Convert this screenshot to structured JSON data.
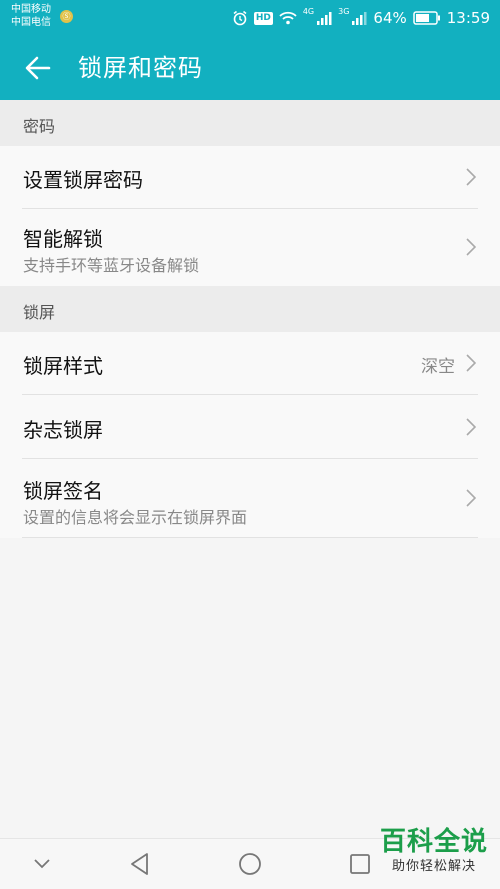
{
  "status_bar": {
    "carrier_1": "中国移动",
    "carrier_2": "中国电信",
    "carrier_badge": "Ⓢ",
    "hd_label": "HD",
    "net_1": "4G",
    "net_2": "3G",
    "battery": "64%",
    "time": "13:59"
  },
  "app_bar": {
    "title": "锁屏和密码"
  },
  "sections": [
    {
      "header": "密码",
      "items": [
        {
          "title": "设置锁屏密码"
        },
        {
          "title": "智能解锁",
          "subtitle": "支持手环等蓝牙设备解锁"
        }
      ]
    },
    {
      "header": "锁屏",
      "items": [
        {
          "title": "锁屏样式",
          "value": "深空"
        },
        {
          "title": "杂志锁屏"
        },
        {
          "title": "锁屏签名",
          "subtitle": "设置的信息将会显示在锁屏界面"
        }
      ]
    }
  ],
  "watermark": {
    "main": "百科全说",
    "sub": "助你轻松解决"
  },
  "colors": {
    "accent": "#12b0c0",
    "watermark": "#1c9e4a"
  }
}
